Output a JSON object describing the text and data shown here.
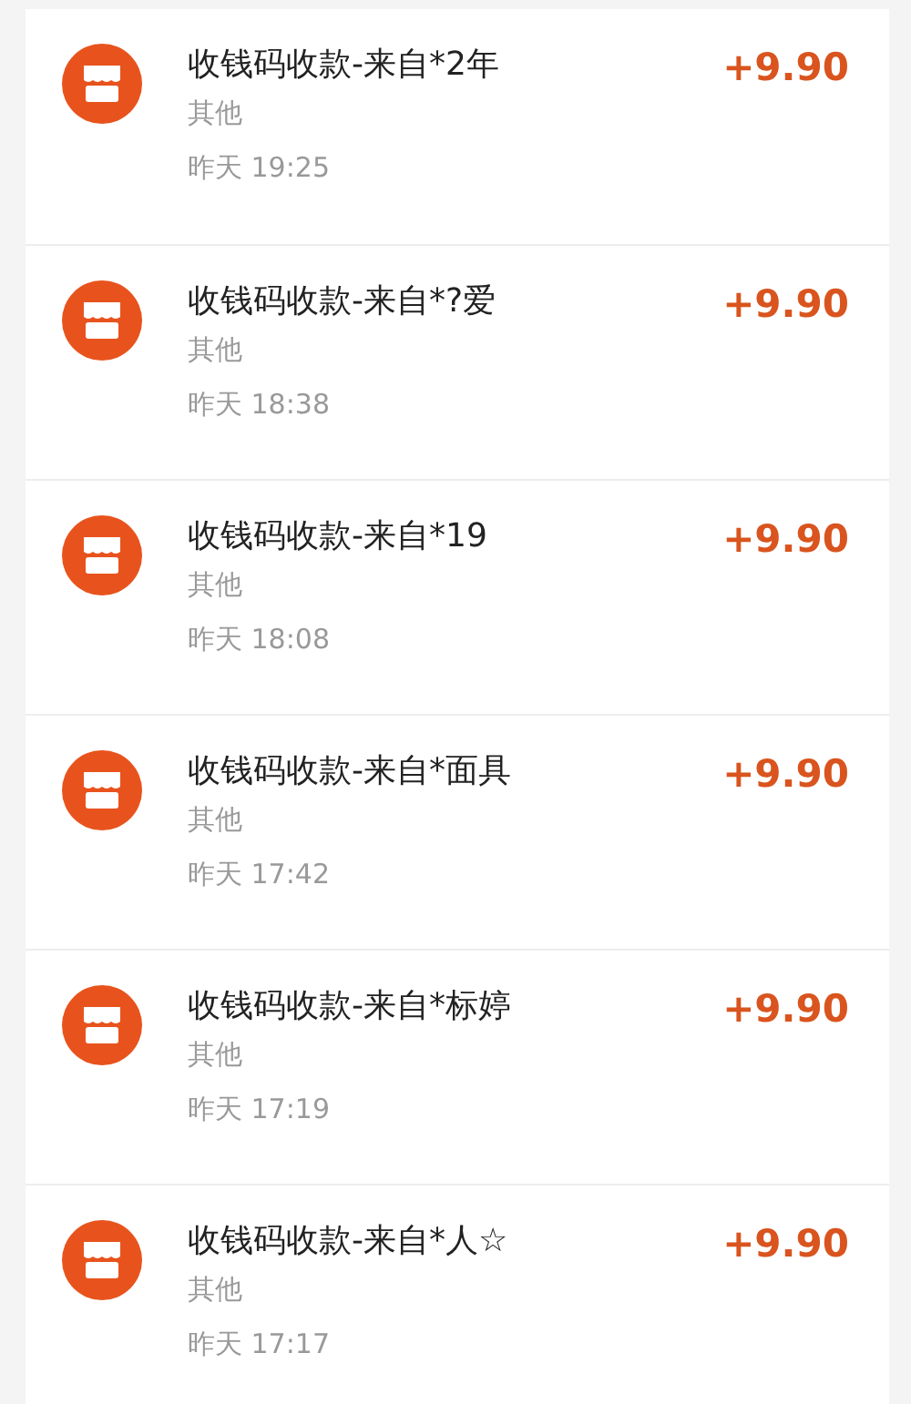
{
  "transactions": [
    {
      "title": "收钱码收款-来自*2年",
      "category": "其他",
      "time": "昨天 19:25",
      "amount": "+9.90"
    },
    {
      "title": "收钱码收款-来自*?爱",
      "category": "其他",
      "time": "昨天 18:38",
      "amount": "+9.90"
    },
    {
      "title": "收钱码收款-来自*19",
      "category": "其他",
      "time": "昨天 18:08",
      "amount": "+9.90"
    },
    {
      "title": "收钱码收款-来自*面具",
      "category": "其他",
      "time": "昨天 17:42",
      "amount": "+9.90"
    },
    {
      "title": "收钱码收款-来自*标婷",
      "category": "其他",
      "time": "昨天 17:19",
      "amount": "+9.90"
    },
    {
      "title": "收钱码收款-来自*人☆",
      "category": "其他",
      "time": "昨天 17:17",
      "amount": "+9.90"
    }
  ]
}
